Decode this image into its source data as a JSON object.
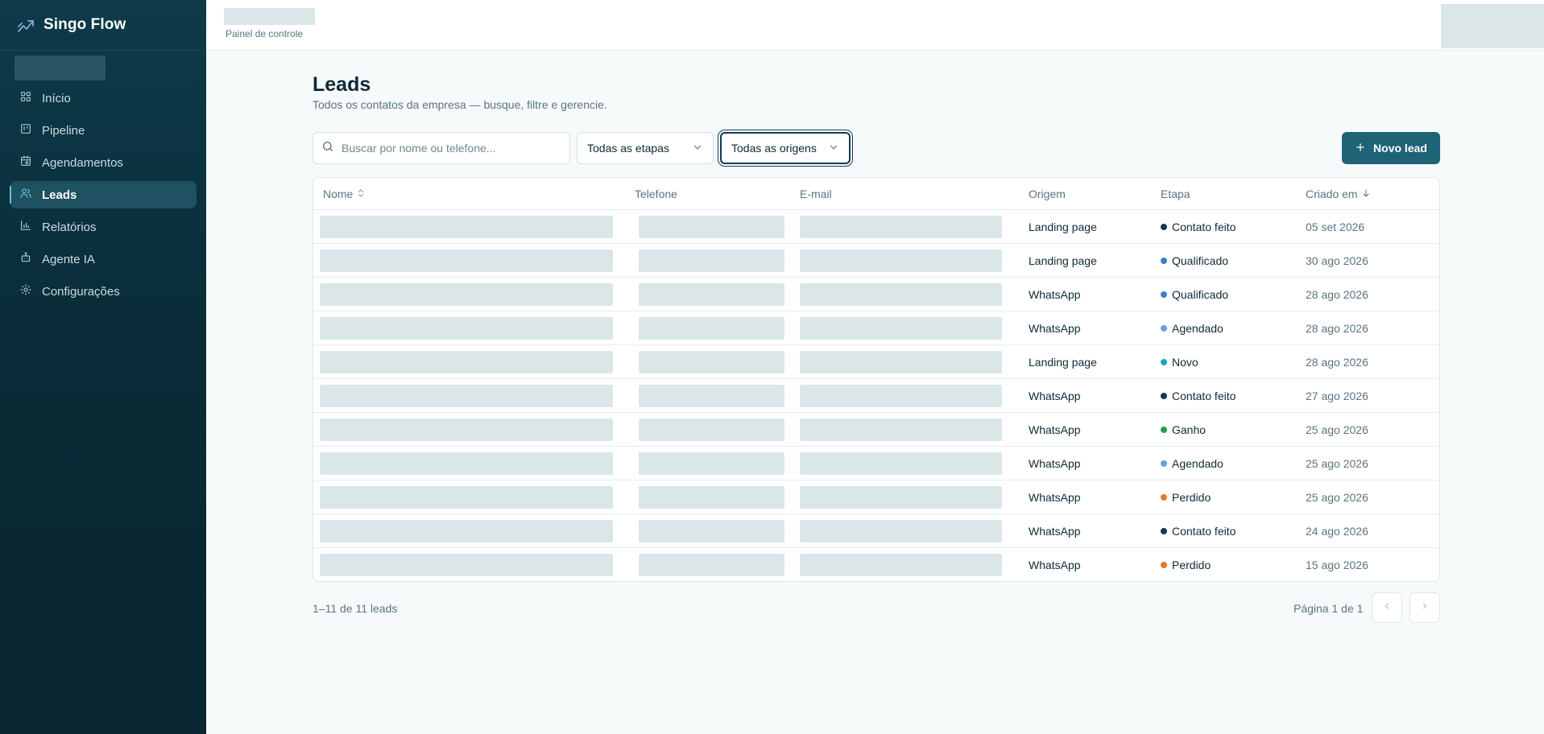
{
  "brand": {
    "name": "Singo Flow"
  },
  "sidebar": {
    "items": [
      {
        "label": "Início",
        "icon": "layout-grid-icon",
        "active": false
      },
      {
        "label": "Pipeline",
        "icon": "kanban-icon",
        "active": false
      },
      {
        "label": "Agendamentos",
        "icon": "calendar-icon",
        "active": false
      },
      {
        "label": "Leads",
        "icon": "users-icon",
        "active": true
      },
      {
        "label": "Relatórios",
        "icon": "bar-chart-icon",
        "active": false
      },
      {
        "label": "Agente IA",
        "icon": "bot-icon",
        "active": false
      },
      {
        "label": "Configurações",
        "icon": "gear-icon",
        "active": false
      }
    ]
  },
  "topbar": {
    "breadcrumb": "Painel de controle"
  },
  "page": {
    "title": "Leads",
    "subtitle": "Todos os contatos da empresa — busque, filtre e gerencie."
  },
  "filters": {
    "search_placeholder": "Buscar por nome ou telefone...",
    "stage_select": "Todas as etapas",
    "origin_select": "Todas as origens",
    "new_button": "Novo lead"
  },
  "table": {
    "columns": [
      "Nome",
      "Telefone",
      "E-mail",
      "Origem",
      "Etapa",
      "Criado em"
    ],
    "rows": [
      {
        "origem": "Landing page",
        "etapa": "Contato feito",
        "criado": "05 set 2026"
      },
      {
        "origem": "Landing page",
        "etapa": "Qualificado",
        "criado": "30 ago 2026"
      },
      {
        "origem": "WhatsApp",
        "etapa": "Qualificado",
        "criado": "28 ago 2026"
      },
      {
        "origem": "WhatsApp",
        "etapa": "Agendado",
        "criado": "28 ago 2026"
      },
      {
        "origem": "Landing page",
        "etapa": "Novo",
        "criado": "28 ago 2026"
      },
      {
        "origem": "WhatsApp",
        "etapa": "Contato feito",
        "criado": "27 ago 2026"
      },
      {
        "origem": "WhatsApp",
        "etapa": "Ganho",
        "criado": "25 ago 2026"
      },
      {
        "origem": "WhatsApp",
        "etapa": "Agendado",
        "criado": "25 ago 2026"
      },
      {
        "origem": "WhatsApp",
        "etapa": "Perdido",
        "criado": "25 ago 2026"
      },
      {
        "origem": "WhatsApp",
        "etapa": "Contato feito",
        "criado": "24 ago 2026"
      },
      {
        "origem": "WhatsApp",
        "etapa": "Perdido",
        "criado": "15 ago 2026"
      }
    ]
  },
  "stage_colors": {
    "Contato feito": "#0e3a5a",
    "Qualificado": "#3b82c4",
    "Agendado": "#6aa0d8",
    "Novo": "#1aa3b8",
    "Ganho": "#22a050",
    "Perdido": "#e07a2e"
  },
  "footer": {
    "count": "1–11 de 11 leads",
    "page_info": "Página 1 de 1"
  },
  "colors": {
    "accent": "#1f6377",
    "sidebar": "#0a2c38"
  }
}
